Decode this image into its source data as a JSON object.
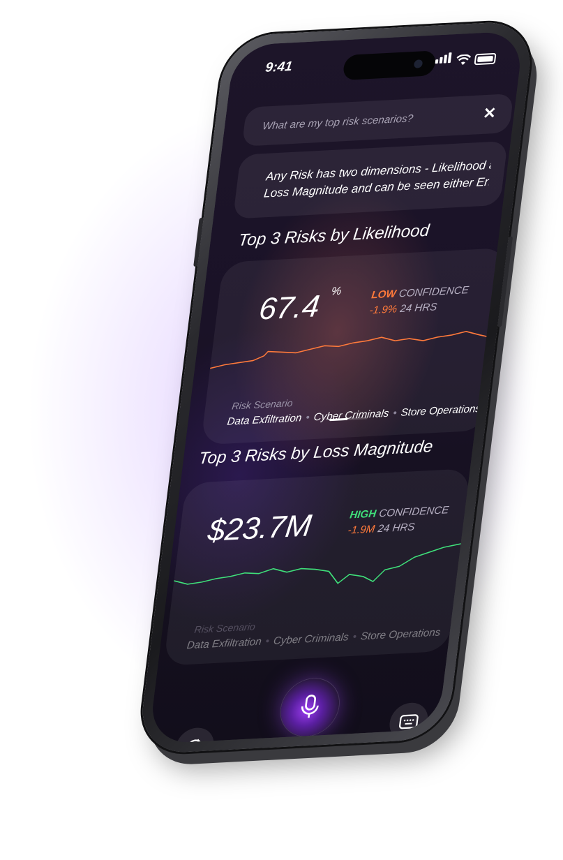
{
  "status_bar": {
    "time": "9:41"
  },
  "assistant": {
    "query_placeholder": "What are my top risk scenarios?",
    "close_symbol": "✕",
    "answer_text_line1": "Any Risk has two dimensions - Likelihood and",
    "answer_text_line2": "Loss Magnitude and can be seen either Enter..."
  },
  "likelihood_section": {
    "title": "Top 3 Risks by Likelihood",
    "value": "67.4",
    "unit": "%",
    "confidence_level": "LOW",
    "confidence_word": "CONFIDENCE",
    "change": "-1.9%",
    "period": "24 HRS",
    "accent_color": "#ff7a3b",
    "risk_scenario_label": "Risk Scenario",
    "scenario_items": [
      "Data Exfiltration",
      "Cyber Criminals",
      "Store Operations"
    ]
  },
  "loss_section": {
    "title": "Top 3 Risks by Loss Magnitude",
    "value": "$23.7M",
    "confidence_level": "HIGH",
    "confidence_word": "CONFIDENCE",
    "change": "-1.9M",
    "period": "24 HRS",
    "accent_color": "#3fe07a",
    "risk_scenario_label": "Risk Scenario",
    "scenario_items": [
      "Data Exfiltration",
      "Cyber Criminals",
      "Store Operations"
    ]
  },
  "pager": {
    "pages": 2,
    "active": 1
  },
  "bottom_bar": {
    "left_icon": "history-icon",
    "center_icon": "microphone-icon",
    "right_icon": "keyboard-icon"
  }
}
